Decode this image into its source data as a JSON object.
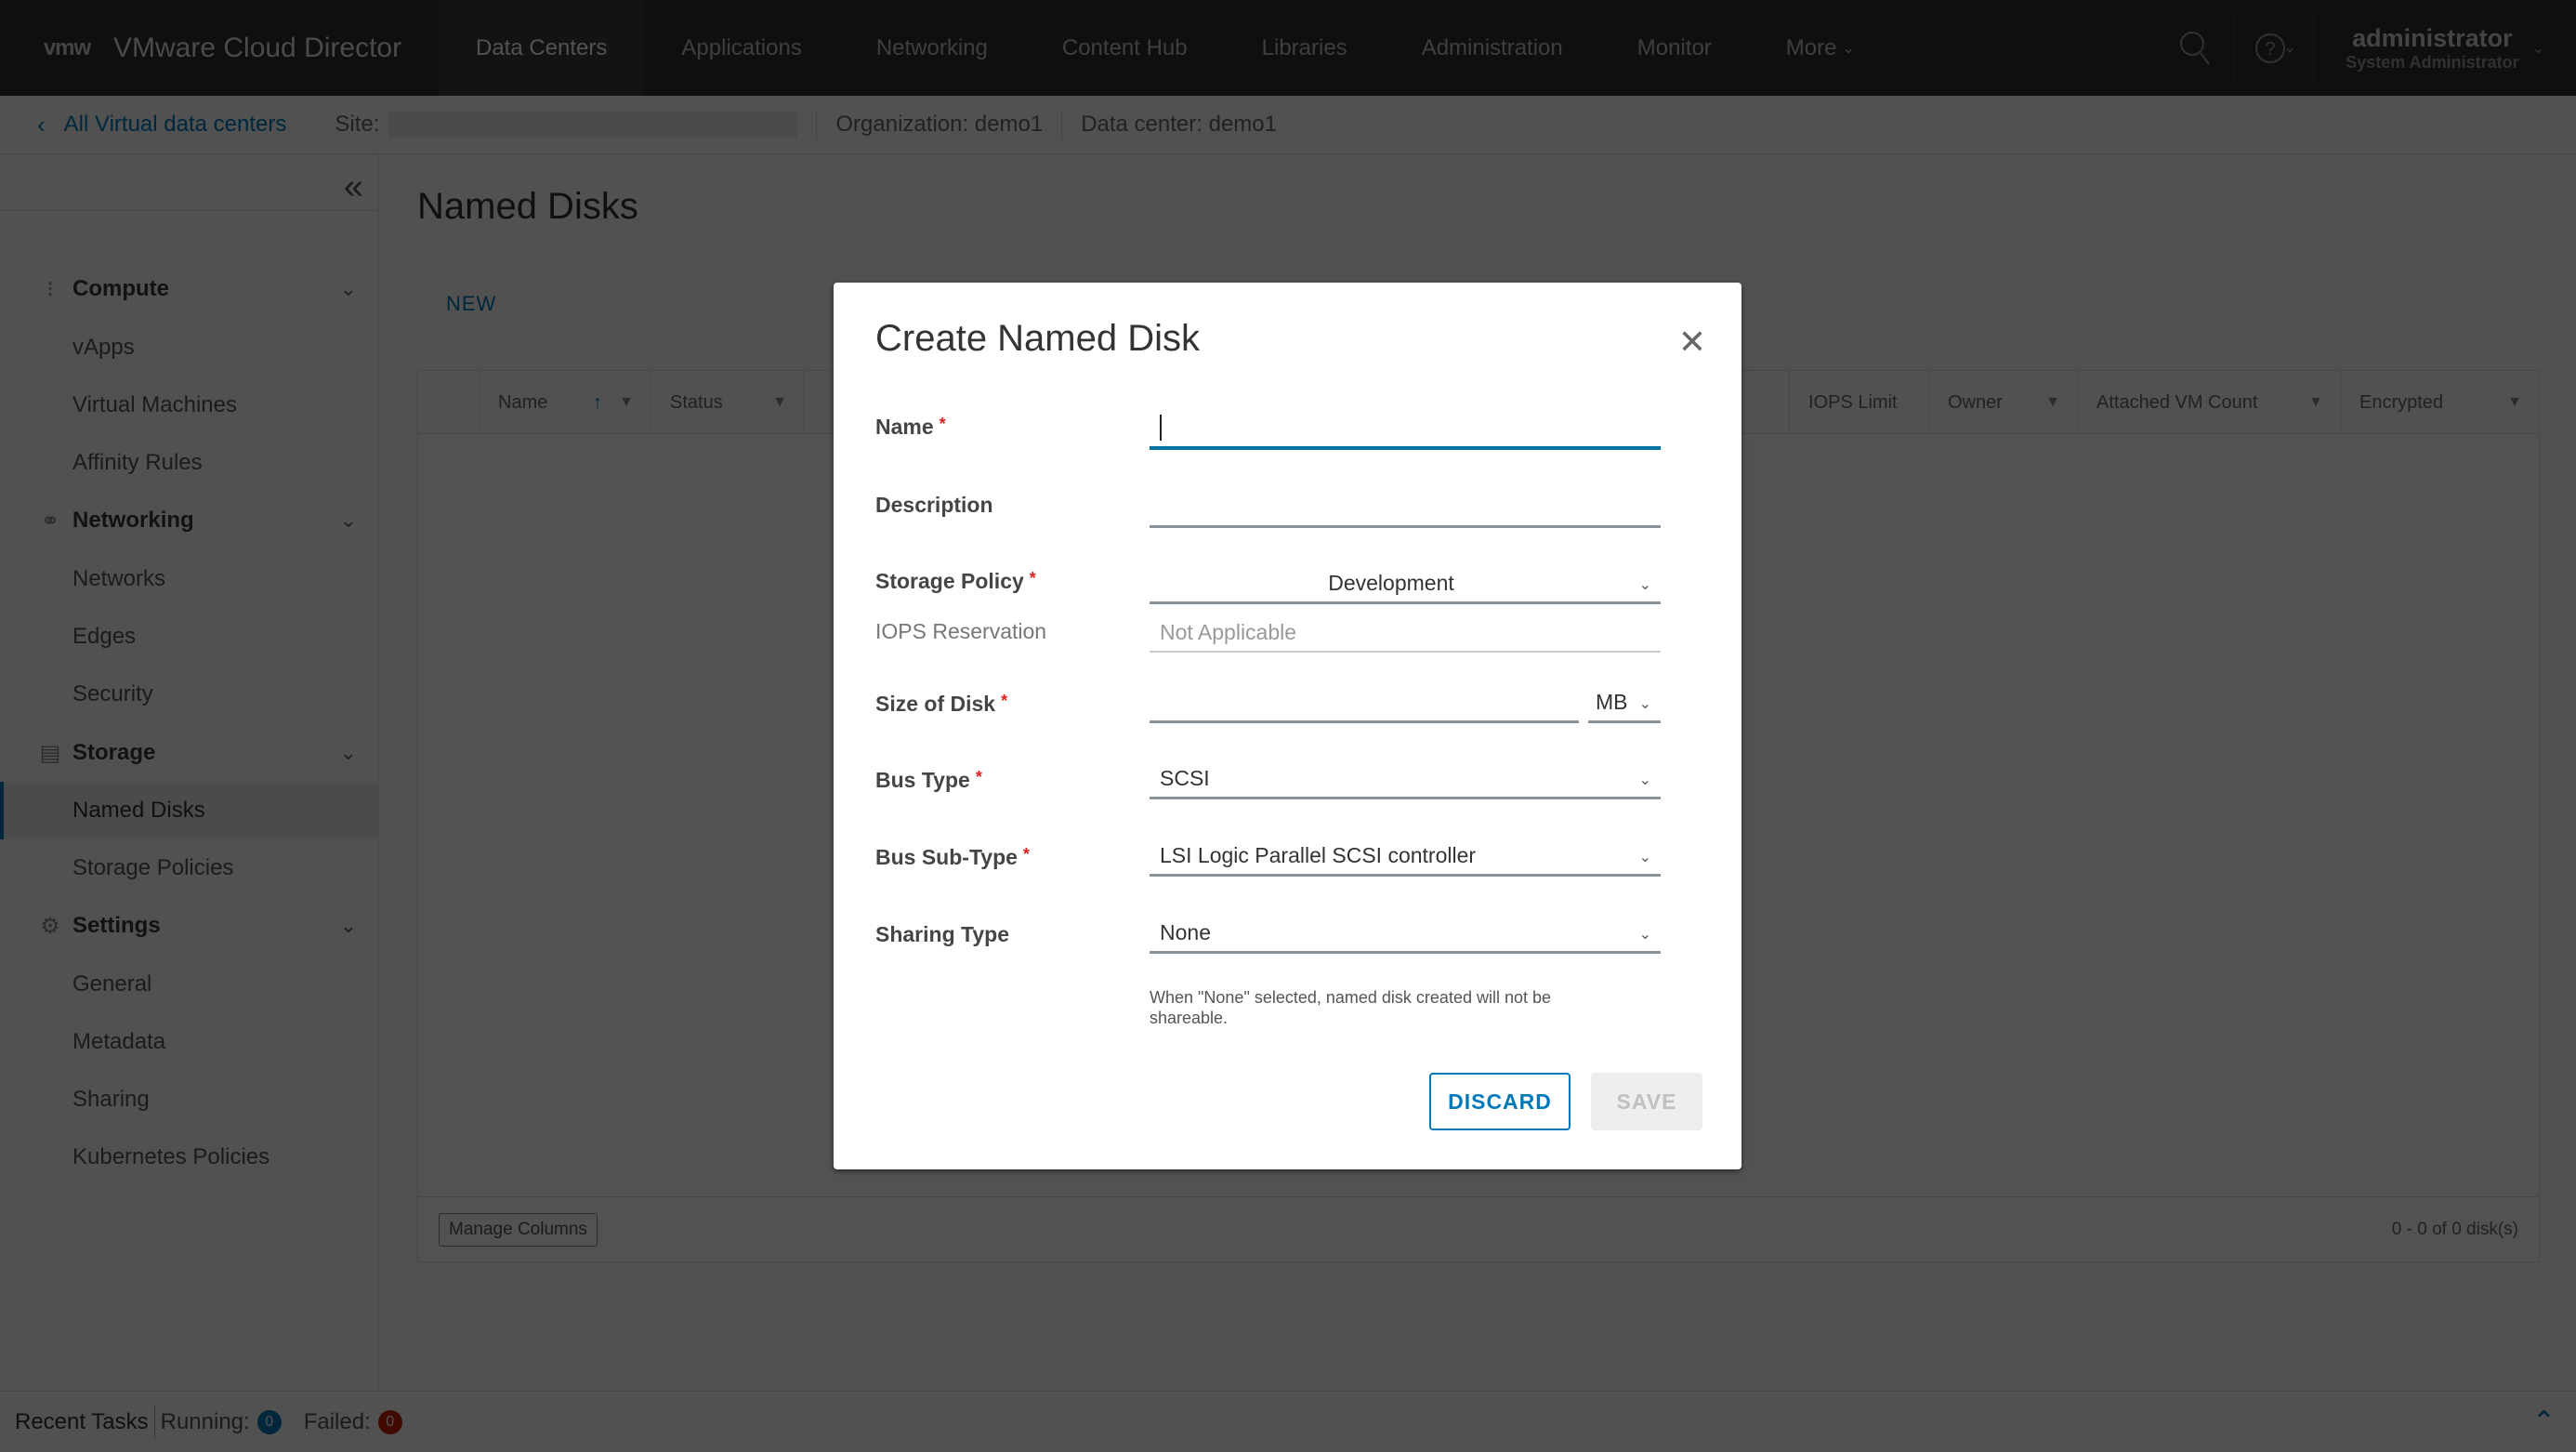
{
  "header": {
    "logo_text": "vmw",
    "app_title": "VMware Cloud Director",
    "nav": [
      {
        "label": "Data Centers",
        "active": true
      },
      {
        "label": "Applications"
      },
      {
        "label": "Networking"
      },
      {
        "label": "Content Hub"
      },
      {
        "label": "Libraries"
      },
      {
        "label": "Administration"
      },
      {
        "label": "Monitor"
      },
      {
        "label": "More"
      }
    ],
    "icons": {
      "search": "search-icon",
      "help": "help-icon"
    },
    "user": {
      "name": "administrator",
      "role": "System Administrator"
    }
  },
  "subheader": {
    "back_label": "All Virtual data centers",
    "site_label": "Site:",
    "organization": "Organization: demo1",
    "data_center": "Data center: demo1"
  },
  "sidebar": {
    "groups": [
      {
        "label": "Compute",
        "icon": "grid-icon",
        "items": [
          "vApps",
          "Virtual Machines",
          "Affinity Rules"
        ]
      },
      {
        "label": "Networking",
        "icon": "globe-icon",
        "items": [
          "Networks",
          "Edges",
          "Security"
        ]
      },
      {
        "label": "Storage",
        "icon": "database-icon",
        "items": [
          "Named Disks",
          "Storage Policies"
        ]
      },
      {
        "label": "Settings",
        "icon": "gear-icon",
        "items": [
          "General",
          "Metadata",
          "Sharing",
          "Kubernetes Policies"
        ]
      }
    ],
    "active_item": "Named Disks"
  },
  "main": {
    "title": "Named Disks",
    "new_button": "NEW",
    "columns": [
      "Name",
      "Status",
      "IOPS Limit",
      "Owner",
      "Attached VM Count",
      "Encrypted"
    ],
    "manage_columns": "Manage Columns",
    "pagination": "0 - 0 of 0 disk(s)"
  },
  "tasks": {
    "label": "Recent Tasks",
    "running_label": "Running:",
    "running_count": "0",
    "failed_label": "Failed:",
    "failed_count": "0"
  },
  "modal": {
    "title": "Create Named Disk",
    "fields": {
      "name": {
        "label": "Name",
        "required": true,
        "value": ""
      },
      "description": {
        "label": "Description",
        "value": ""
      },
      "storage_policy": {
        "label": "Storage Policy",
        "required": true,
        "value": "Development"
      },
      "iops_reservation": {
        "label": "IOPS Reservation",
        "placeholder": "Not Applicable"
      },
      "size": {
        "label": "Size of Disk",
        "required": true,
        "value": "",
        "unit": "MB"
      },
      "bus_type": {
        "label": "Bus Type",
        "required": true,
        "value": "SCSI"
      },
      "bus_sub_type": {
        "label": "Bus Sub-Type",
        "required": true,
        "value": "LSI Logic Parallel SCSI controller"
      },
      "sharing_type": {
        "label": "Sharing Type",
        "value": "None"
      }
    },
    "helper_text": "When \"None\" selected, named disk created will not be shareable.",
    "discard_label": "DISCARD",
    "save_label": "SAVE",
    "required_mark": "*"
  },
  "colors": {
    "accent": "#0079b8",
    "required": "#e02020",
    "failed": "#c92100"
  }
}
